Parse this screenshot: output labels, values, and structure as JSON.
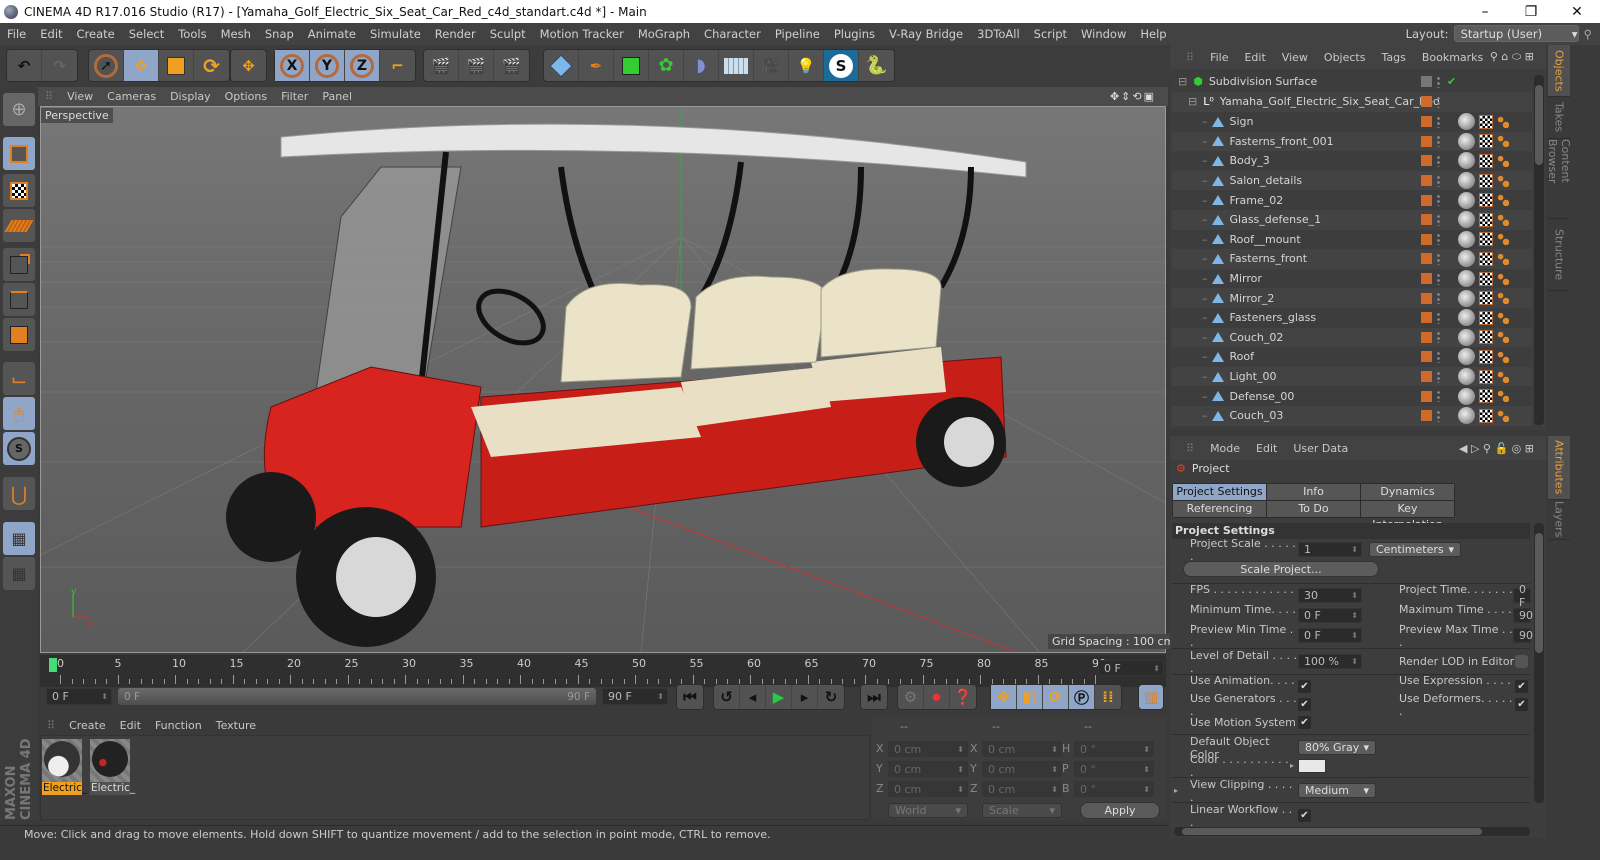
{
  "window": {
    "title": "CINEMA 4D R17.016 Studio (R17) - [Yamaha_Golf_Electric_Six_Seat_Car_Red_c4d_standart.c4d *] - Main",
    "controls": {
      "minimize": "–",
      "maximize": "❐",
      "close": "✕"
    }
  },
  "menubar": {
    "items": [
      "File",
      "Edit",
      "Create",
      "Select",
      "Tools",
      "Mesh",
      "Snap",
      "Animate",
      "Simulate",
      "Render",
      "Sculpt",
      "Motion Tracker",
      "MoGraph",
      "Character",
      "Pipeline",
      "Plugins",
      "V-Ray Bridge",
      "3DToAll",
      "Script",
      "Window",
      "Help"
    ],
    "layout_label": "Layout:",
    "layout_value": "Startup (User)"
  },
  "toolbar": {
    "icons": [
      "undo-icon",
      "redo-icon",
      "live-selection-icon",
      "move-icon",
      "scale-icon",
      "rotate-icon",
      "recent-tool-icon",
      "x-axis-icon",
      "y-axis-icon",
      "z-axis-icon",
      "coordinate-system-icon",
      "render-view-icon",
      "render-picture-viewer-icon",
      "render-settings-icon",
      "cube-icon",
      "pen-icon",
      "subdivision-icon",
      "cloner-icon",
      "deformer-icon",
      "floor-icon",
      "camera-icon",
      "light-icon",
      "plugin-icon",
      "python-icon"
    ],
    "axis_labels": [
      "X",
      "Y",
      "Z"
    ]
  },
  "viewport": {
    "menu": [
      "View",
      "Cameras",
      "Display",
      "Options",
      "Filter",
      "Panel"
    ],
    "camera_label": "Perspective",
    "grid_spacing": "Grid Spacing : 100 cm",
    "axis_labels": {
      "y": "y",
      "x": "x",
      "z": "z"
    }
  },
  "timeline": {
    "ticks": [
      "0",
      "5",
      "10",
      "15",
      "20",
      "25",
      "30",
      "35",
      "40",
      "45",
      "50",
      "55",
      "60",
      "65",
      "70",
      "75",
      "80",
      "85",
      "90"
    ],
    "current_frame": "0 F",
    "start_field": "0 F",
    "range_start": "0 F",
    "range_end": "90 F",
    "end_field": "90 F",
    "current_field": "0 F"
  },
  "material_manager": {
    "menu": [
      "Create",
      "Edit",
      "Function",
      "Texture"
    ],
    "materials": [
      {
        "label": "Electric_",
        "selected": true
      },
      {
        "label": "Electric_",
        "selected": false
      }
    ],
    "brand": "MAXON CINEMA 4D"
  },
  "coordinates": {
    "headers": [
      "--",
      "--",
      "--"
    ],
    "rows": [
      {
        "a": "X",
        "av": "0 cm",
        "b": "X",
        "bv": "0 cm",
        "c": "H",
        "cv": "0 °"
      },
      {
        "a": "Y",
        "av": "0 cm",
        "b": "Y",
        "bv": "0 cm",
        "c": "P",
        "cv": "0 °"
      },
      {
        "a": "Z",
        "av": "0 cm",
        "b": "Z",
        "bv": "0 cm",
        "c": "B",
        "cv": "0 °"
      }
    ],
    "mode": "World",
    "size_mode": "Scale",
    "apply": "Apply"
  },
  "status": "Move: Click and drag to move elements. Hold down SHIFT to quantize movement / add to the selection in point mode, CTRL to remove.",
  "object_manager": {
    "menu": [
      "File",
      "Edit",
      "View",
      "Objects",
      "Tags",
      "Bookmarks"
    ],
    "root": "Subdivision Surface",
    "group": "Yamaha_Golf_Electric_Six_Seat_Car_Red",
    "objects": [
      "Sign",
      "Fasterns_front_001",
      "Body_3",
      "Salon_details",
      "Frame_02",
      "Glass_defense_1",
      "Roof__mount",
      "Fasterns_front",
      "Mirror",
      "Mirror_2",
      "Fasteners_glass",
      "Couch_02",
      "Roof",
      "Light_00",
      "Defense_00",
      "Couch_03"
    ]
  },
  "side_tabs_top": [
    "Objects",
    "Takes",
    "Content Browser",
    "Structure"
  ],
  "side_tabs_bottom": [
    "Attributes",
    "Layers"
  ],
  "attributes": {
    "menu": [
      "Mode",
      "Edit",
      "User Data"
    ],
    "object": "Project",
    "tabs": [
      "Project Settings",
      "Info",
      "Dynamics",
      "Referencing",
      "To Do",
      "Key Interpolation"
    ],
    "section": "Project Settings",
    "project_scale_label": "Project Scale . . . . . .",
    "project_scale": "1",
    "project_scale_unit": "Centimeters",
    "scale_project_btn": "Scale Project...",
    "fps_label": "FPS . . . . . . . . . . . . . .",
    "fps": "30",
    "min_time_label": "Minimum Time. . . . .",
    "min_time": "0 F",
    "prev_min_label": "Preview Min Time . .",
    "prev_min": "0 F",
    "project_time_label": "Project Time. . . . . . . .",
    "project_time": "0 F",
    "max_time_label": "Maximum Time . . . . .",
    "max_time": "90",
    "prev_max_label": "Preview Max Time . . .",
    "prev_max": "90",
    "lod_label": "Level of Detail . . . . .",
    "lod": "100 %",
    "render_lod_label": "Render LOD in Editor",
    "use_animation_label": "Use Animation. . . . .",
    "use_generators_label": "Use Generators . . . .",
    "use_motion_label": "Use Motion System",
    "use_expression_label": "Use Expression . . . . .",
    "use_deformers_label": "Use Deformers. . . . . .",
    "default_color_label": "Default Object Color",
    "default_color": "80% Gray",
    "color_label": "Color . . . . . . . . . . .",
    "color_value": "#e8e8e8",
    "view_clipping_label": "View Clipping . . . . .",
    "view_clipping": "Medium",
    "linear_workflow_label": "Linear Workflow . . .",
    "checkmark": "✔"
  },
  "colors": {
    "accent_blue": "#8fa6c8",
    "object_orange": "#d06a2a",
    "tab_active": "#e8a040",
    "car_red": "#d8241e"
  }
}
